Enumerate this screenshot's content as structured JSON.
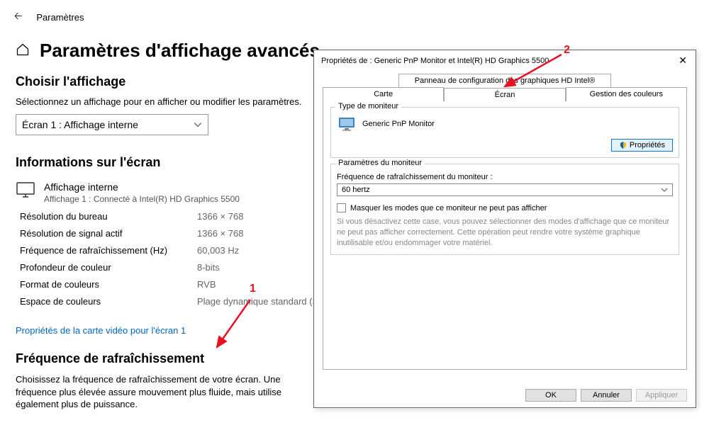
{
  "topbar": {
    "title": "Paramètres"
  },
  "page": {
    "title": "Paramètres d'affichage avancés"
  },
  "choose": {
    "heading": "Choisir l'affichage",
    "desc": "Sélectionnez un affichage pour en afficher ou modifier les paramètres.",
    "selected": "Écran 1 : Affichage interne"
  },
  "info": {
    "heading": "Informations sur l'écran",
    "monitor_name": "Affichage interne",
    "monitor_sub": "Affichage 1 : Connecté à Intel(R) HD Graphics 5500",
    "rows": [
      {
        "label": "Résolution du bureau",
        "value": "1366 × 768"
      },
      {
        "label": "Résolution de signal actif",
        "value": "1366 × 768"
      },
      {
        "label": "Fréquence de rafraîchissement (Hz)",
        "value": "60,003 Hz"
      },
      {
        "label": "Profondeur de couleur",
        "value": "8-bits"
      },
      {
        "label": "Format de couleurs",
        "value": "RVB"
      },
      {
        "label": "Espace de couleurs",
        "value": "Plage dynamique standard (SDR)"
      }
    ],
    "link": "Propriétés de la carte vidéo pour l'écran 1"
  },
  "refresh": {
    "heading": "Fréquence de rafraîchissement",
    "desc": "Choisissez la fréquence de rafraîchissement de votre écran. Une fréquence plus élevée assure mouvement plus fluide, mais utilise également plus de puissance."
  },
  "dialog": {
    "title": "Propriétés de : Generic PnP Monitor et Intel(R) HD Graphics 5500",
    "tab_upper": "Panneau de configuration des graphiques HD Intel®",
    "tabs": [
      "Carte",
      "Écran",
      "Gestion des couleurs"
    ],
    "active_tab": "Écran",
    "group_monitor": "Type de moniteur",
    "monitor_name": "Generic PnP Monitor",
    "properties_btn": "Propriétés",
    "group_settings": "Paramètres du moniteur",
    "refresh_label": "Fréquence de rafraîchissement du moniteur :",
    "refresh_value": "60 hertz",
    "hide_modes": "Masquer les modes que ce moniteur ne peut pas afficher",
    "hide_hint": "Si vous désactivez cette case, vous pouvez sélectionner des modes d'affichage que ce moniteur ne peut pas afficher correctement. Cette opération peut rendre votre système graphique inutilisable et/ou endommager votre matériel.",
    "ok": "OK",
    "cancel": "Annuler",
    "apply": "Appliquer"
  },
  "annotations": {
    "one": "1",
    "two": "2"
  }
}
